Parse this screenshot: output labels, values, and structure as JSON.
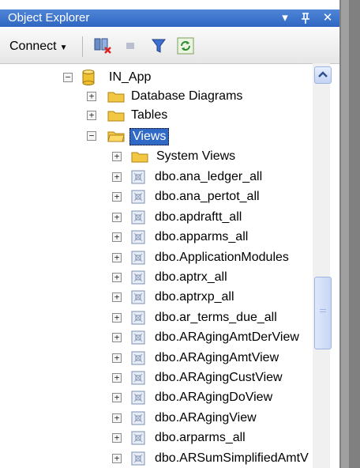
{
  "window": {
    "title": "Object Explorer",
    "dropdown_glyph": "▾",
    "pin_glyph": "ᵖ",
    "close_glyph": "✕"
  },
  "toolbar": {
    "connect_label": "Connect",
    "connect_arrow": "▼",
    "icons": [
      "register-servers-icon",
      "stop-icon",
      "filter-icon",
      "refresh-icon"
    ]
  },
  "tree": {
    "database": {
      "label": "IN_App",
      "expander": "−"
    },
    "folders": [
      {
        "label": "Database Diagrams",
        "expander": "+"
      },
      {
        "label": "Tables",
        "expander": "+"
      },
      {
        "label": "Views",
        "expander": "−",
        "selected": true
      }
    ],
    "system_views": {
      "label": "System Views",
      "expander": "+"
    },
    "views": [
      "dbo.ana_ledger_all",
      "dbo.ana_pertot_all",
      "dbo.apdraftt_all",
      "dbo.apparms_all",
      "dbo.ApplicationModules",
      "dbo.aptrx_all",
      "dbo.aptrxp_all",
      "dbo.ar_terms_due_all",
      "dbo.ARAgingAmtDerView",
      "dbo.ARAgingAmtView",
      "dbo.ARAgingCustView",
      "dbo.ARAgingDoView",
      "dbo.ARAgingView",
      "dbo.arparms_all",
      "dbo.ARSumSimplifiedAmtV"
    ]
  },
  "colors": {
    "titlebar": "#2f66c2",
    "selection": "#3169c6",
    "folder": "#f2c744",
    "view_icon": "#7a8fb0"
  }
}
